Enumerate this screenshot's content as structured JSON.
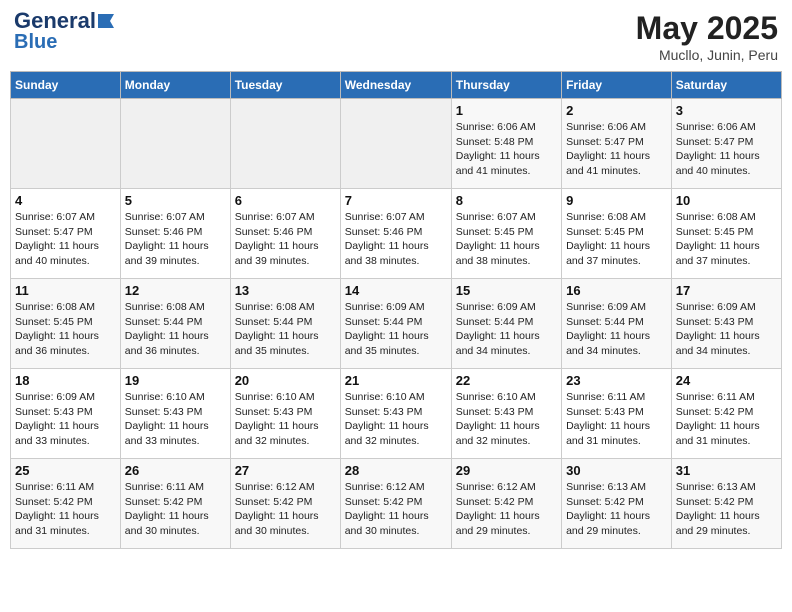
{
  "header": {
    "logo_general": "General",
    "logo_blue": "Blue",
    "title": "May 2025",
    "location": "Mucllo, Junin, Peru"
  },
  "weekdays": [
    "Sunday",
    "Monday",
    "Tuesday",
    "Wednesday",
    "Thursday",
    "Friday",
    "Saturday"
  ],
  "weeks": [
    [
      {
        "day": "",
        "sunrise": "",
        "sunset": "",
        "daylight": "",
        "empty": true
      },
      {
        "day": "",
        "sunrise": "",
        "sunset": "",
        "daylight": "",
        "empty": true
      },
      {
        "day": "",
        "sunrise": "",
        "sunset": "",
        "daylight": "",
        "empty": true
      },
      {
        "day": "",
        "sunrise": "",
        "sunset": "",
        "daylight": "",
        "empty": true
      },
      {
        "day": "1",
        "sunrise": "Sunrise: 6:06 AM",
        "sunset": "Sunset: 5:48 PM",
        "daylight": "Daylight: 11 hours and 41 minutes."
      },
      {
        "day": "2",
        "sunrise": "Sunrise: 6:06 AM",
        "sunset": "Sunset: 5:47 PM",
        "daylight": "Daylight: 11 hours and 41 minutes."
      },
      {
        "day": "3",
        "sunrise": "Sunrise: 6:06 AM",
        "sunset": "Sunset: 5:47 PM",
        "daylight": "Daylight: 11 hours and 40 minutes."
      }
    ],
    [
      {
        "day": "4",
        "sunrise": "Sunrise: 6:07 AM",
        "sunset": "Sunset: 5:47 PM",
        "daylight": "Daylight: 11 hours and 40 minutes."
      },
      {
        "day": "5",
        "sunrise": "Sunrise: 6:07 AM",
        "sunset": "Sunset: 5:46 PM",
        "daylight": "Daylight: 11 hours and 39 minutes."
      },
      {
        "day": "6",
        "sunrise": "Sunrise: 6:07 AM",
        "sunset": "Sunset: 5:46 PM",
        "daylight": "Daylight: 11 hours and 39 minutes."
      },
      {
        "day": "7",
        "sunrise": "Sunrise: 6:07 AM",
        "sunset": "Sunset: 5:46 PM",
        "daylight": "Daylight: 11 hours and 38 minutes."
      },
      {
        "day": "8",
        "sunrise": "Sunrise: 6:07 AM",
        "sunset": "Sunset: 5:45 PM",
        "daylight": "Daylight: 11 hours and 38 minutes."
      },
      {
        "day": "9",
        "sunrise": "Sunrise: 6:08 AM",
        "sunset": "Sunset: 5:45 PM",
        "daylight": "Daylight: 11 hours and 37 minutes."
      },
      {
        "day": "10",
        "sunrise": "Sunrise: 6:08 AM",
        "sunset": "Sunset: 5:45 PM",
        "daylight": "Daylight: 11 hours and 37 minutes."
      }
    ],
    [
      {
        "day": "11",
        "sunrise": "Sunrise: 6:08 AM",
        "sunset": "Sunset: 5:45 PM",
        "daylight": "Daylight: 11 hours and 36 minutes."
      },
      {
        "day": "12",
        "sunrise": "Sunrise: 6:08 AM",
        "sunset": "Sunset: 5:44 PM",
        "daylight": "Daylight: 11 hours and 36 minutes."
      },
      {
        "day": "13",
        "sunrise": "Sunrise: 6:08 AM",
        "sunset": "Sunset: 5:44 PM",
        "daylight": "Daylight: 11 hours and 35 minutes."
      },
      {
        "day": "14",
        "sunrise": "Sunrise: 6:09 AM",
        "sunset": "Sunset: 5:44 PM",
        "daylight": "Daylight: 11 hours and 35 minutes."
      },
      {
        "day": "15",
        "sunrise": "Sunrise: 6:09 AM",
        "sunset": "Sunset: 5:44 PM",
        "daylight": "Daylight: 11 hours and 34 minutes."
      },
      {
        "day": "16",
        "sunrise": "Sunrise: 6:09 AM",
        "sunset": "Sunset: 5:44 PM",
        "daylight": "Daylight: 11 hours and 34 minutes."
      },
      {
        "day": "17",
        "sunrise": "Sunrise: 6:09 AM",
        "sunset": "Sunset: 5:43 PM",
        "daylight": "Daylight: 11 hours and 34 minutes."
      }
    ],
    [
      {
        "day": "18",
        "sunrise": "Sunrise: 6:09 AM",
        "sunset": "Sunset: 5:43 PM",
        "daylight": "Daylight: 11 hours and 33 minutes."
      },
      {
        "day": "19",
        "sunrise": "Sunrise: 6:10 AM",
        "sunset": "Sunset: 5:43 PM",
        "daylight": "Daylight: 11 hours and 33 minutes."
      },
      {
        "day": "20",
        "sunrise": "Sunrise: 6:10 AM",
        "sunset": "Sunset: 5:43 PM",
        "daylight": "Daylight: 11 hours and 32 minutes."
      },
      {
        "day": "21",
        "sunrise": "Sunrise: 6:10 AM",
        "sunset": "Sunset: 5:43 PM",
        "daylight": "Daylight: 11 hours and 32 minutes."
      },
      {
        "day": "22",
        "sunrise": "Sunrise: 6:10 AM",
        "sunset": "Sunset: 5:43 PM",
        "daylight": "Daylight: 11 hours and 32 minutes."
      },
      {
        "day": "23",
        "sunrise": "Sunrise: 6:11 AM",
        "sunset": "Sunset: 5:43 PM",
        "daylight": "Daylight: 11 hours and 31 minutes."
      },
      {
        "day": "24",
        "sunrise": "Sunrise: 6:11 AM",
        "sunset": "Sunset: 5:42 PM",
        "daylight": "Daylight: 11 hours and 31 minutes."
      }
    ],
    [
      {
        "day": "25",
        "sunrise": "Sunrise: 6:11 AM",
        "sunset": "Sunset: 5:42 PM",
        "daylight": "Daylight: 11 hours and 31 minutes."
      },
      {
        "day": "26",
        "sunrise": "Sunrise: 6:11 AM",
        "sunset": "Sunset: 5:42 PM",
        "daylight": "Daylight: 11 hours and 30 minutes."
      },
      {
        "day": "27",
        "sunrise": "Sunrise: 6:12 AM",
        "sunset": "Sunset: 5:42 PM",
        "daylight": "Daylight: 11 hours and 30 minutes."
      },
      {
        "day": "28",
        "sunrise": "Sunrise: 6:12 AM",
        "sunset": "Sunset: 5:42 PM",
        "daylight": "Daylight: 11 hours and 30 minutes."
      },
      {
        "day": "29",
        "sunrise": "Sunrise: 6:12 AM",
        "sunset": "Sunset: 5:42 PM",
        "daylight": "Daylight: 11 hours and 29 minutes."
      },
      {
        "day": "30",
        "sunrise": "Sunrise: 6:13 AM",
        "sunset": "Sunset: 5:42 PM",
        "daylight": "Daylight: 11 hours and 29 minutes."
      },
      {
        "day": "31",
        "sunrise": "Sunrise: 6:13 AM",
        "sunset": "Sunset: 5:42 PM",
        "daylight": "Daylight: 11 hours and 29 minutes."
      }
    ]
  ]
}
